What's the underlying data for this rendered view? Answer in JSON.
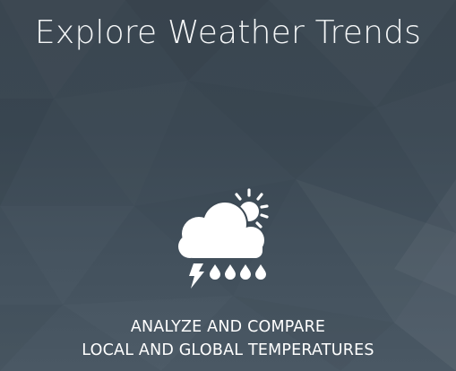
{
  "hero": {
    "title": "Explore Weather Trends",
    "icon": "sun-cloud-thunderstorm-icon",
    "subtitle_line1": "ANALYZE AND COMPARE",
    "subtitle_line2": "LOCAL AND GLOBAL TEMPERATURES"
  },
  "colors": {
    "background": "#3b4853",
    "text": "#ffffff"
  }
}
